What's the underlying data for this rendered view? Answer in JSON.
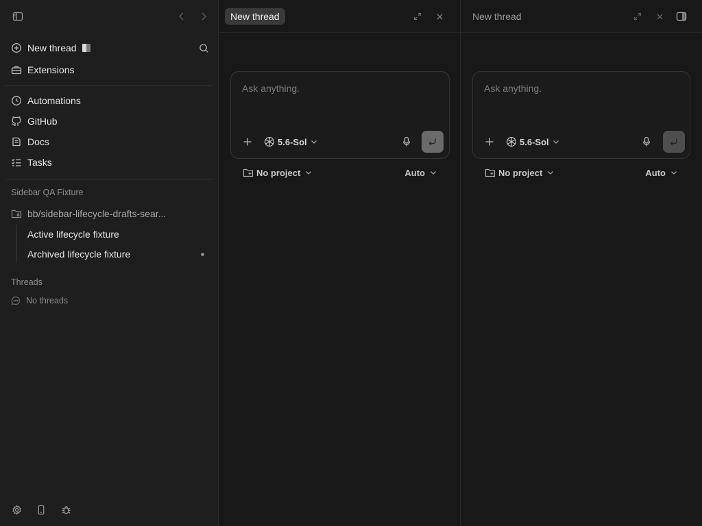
{
  "sidebar": {
    "nav": [
      {
        "label": "New thread",
        "icon": "plus-circle-icon"
      },
      {
        "label": "Extensions",
        "icon": "toolbox-icon"
      }
    ],
    "tools": [
      {
        "label": "Automations",
        "icon": "clock-icon"
      },
      {
        "label": "GitHub",
        "icon": "github-icon"
      },
      {
        "label": "Docs",
        "icon": "docs-icon"
      },
      {
        "label": "Tasks",
        "icon": "tasks-icon"
      }
    ],
    "project_section": "Sidebar QA Fixture",
    "project_path": "bb/sidebar-lifecycle-drafts-sear...",
    "project_threads": [
      {
        "label": "Active lifecycle fixture"
      },
      {
        "label": "Archived lifecycle fixture"
      }
    ],
    "threads_section": "Threads",
    "threads_empty": "No threads"
  },
  "panes": [
    {
      "title": "New thread",
      "composer": {
        "placeholder": "Ask anything.",
        "model": "5.6-Sol"
      },
      "project": "No project",
      "mode": "Auto"
    },
    {
      "title": "New thread",
      "composer": {
        "placeholder": "Ask anything.",
        "model": "5.6-Sol"
      },
      "project": "No project",
      "mode": "Auto"
    }
  ],
  "colors": {
    "background": "#181818",
    "sidebar": "#1e1e1e",
    "accent_tab": "#3a3a3a"
  }
}
